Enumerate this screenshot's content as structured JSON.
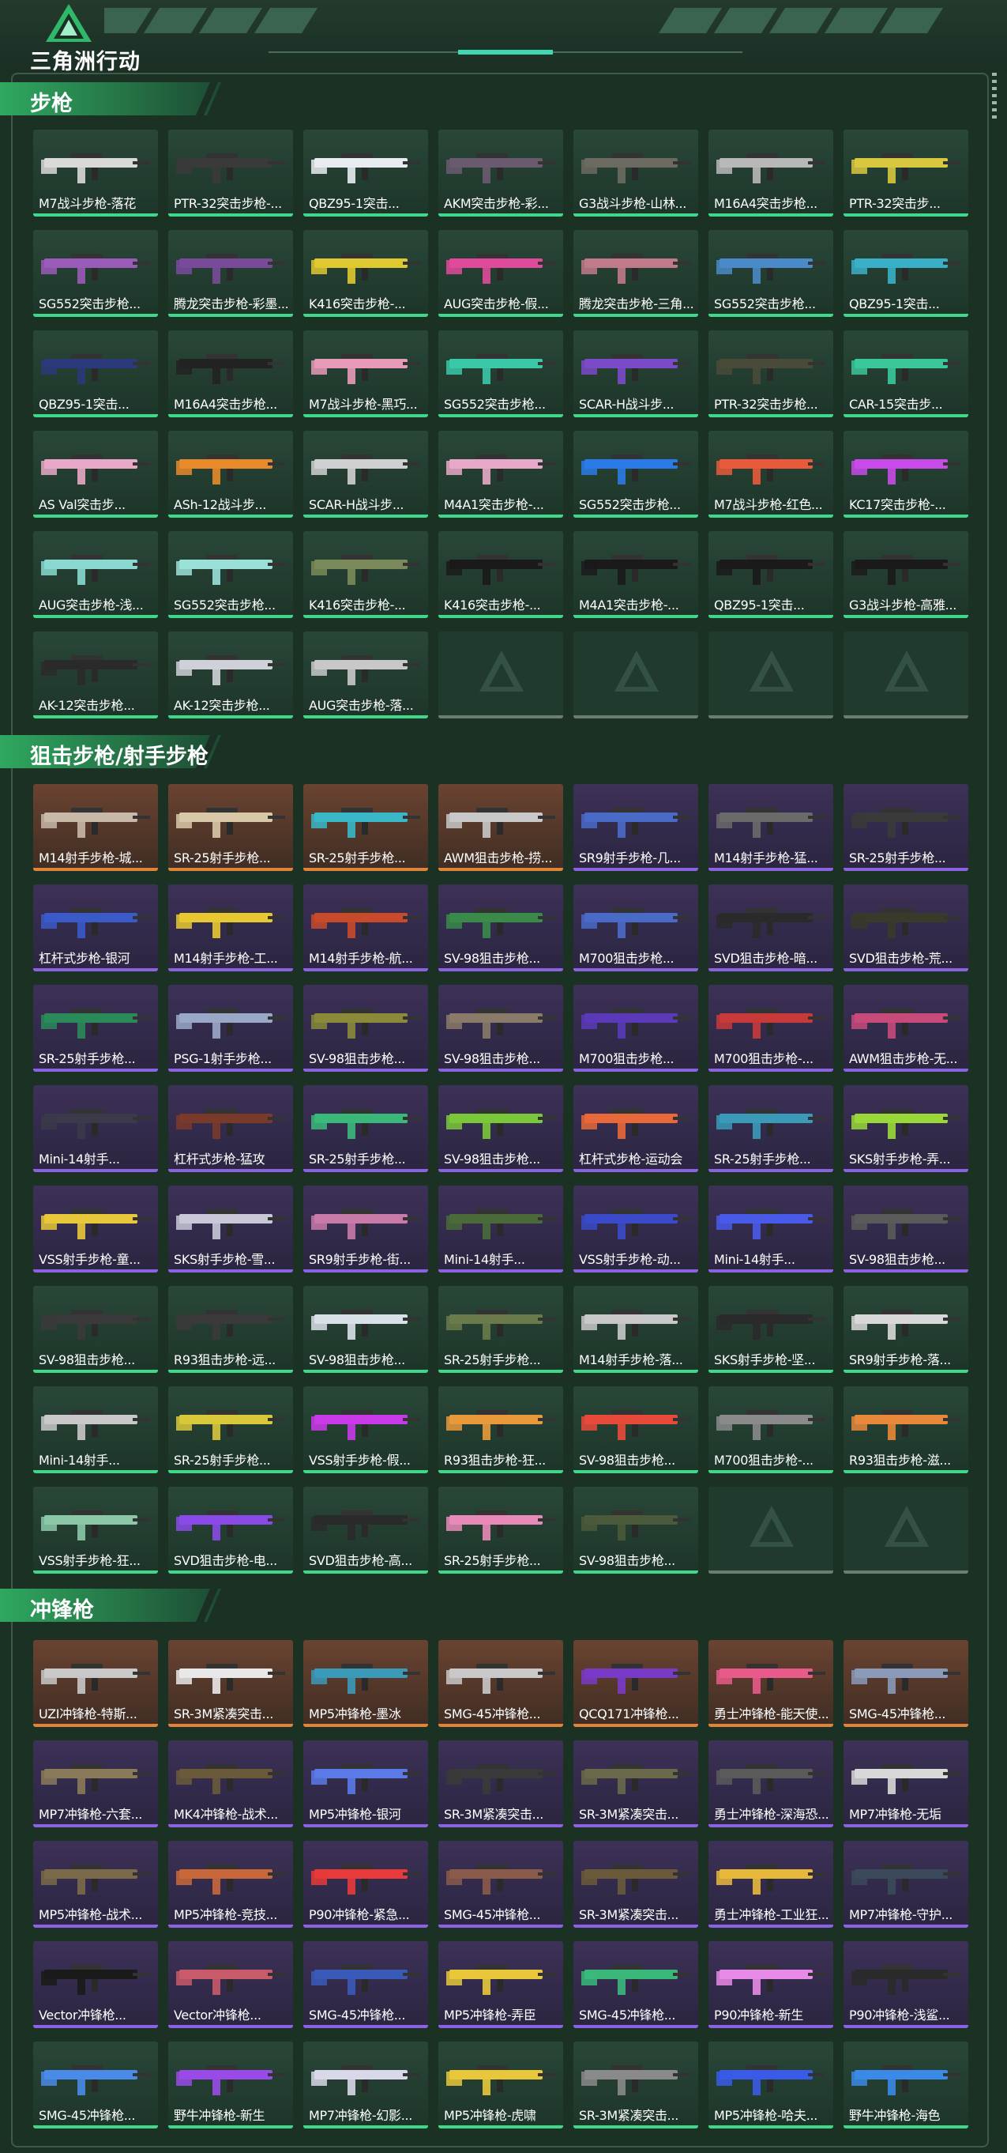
{
  "header": {
    "brand": "三角洲行动",
    "logo_icon": "delta-triangle-logo-icon"
  },
  "colors": {
    "green_rarity": "#3fd88a",
    "purple_rarity": "#8b63e0",
    "orange_rarity": "#e0843a",
    "background": "#1a3124"
  },
  "sections": [
    {
      "title": "步枪",
      "items": [
        {
          "label": "M7战斗步枪-落花",
          "rarity": "green",
          "color": "#d9dad8"
        },
        {
          "label": "PTR-32突击步枪-...",
          "rarity": "green",
          "color": "#3a3a3a"
        },
        {
          "label": "QBZ95-1突击...",
          "rarity": "green",
          "color": "#e8ecf0"
        },
        {
          "label": "AKM突击步枪-彩...",
          "rarity": "green",
          "color": "#6a5a70"
        },
        {
          "label": "G3战斗步枪-山林...",
          "rarity": "green",
          "color": "#6a6a60"
        },
        {
          "label": "M16A4突击步枪...",
          "rarity": "green",
          "color": "#b8b8b8"
        },
        {
          "label": "PTR-32突击步...",
          "rarity": "green",
          "color": "#d8c840"
        },
        {
          "label": "SG552突击步枪...",
          "rarity": "green",
          "color": "#9a5ab8"
        },
        {
          "label": "腾龙突击步枪-彩墨...",
          "rarity": "green",
          "color": "#7a4a9a"
        },
        {
          "label": "K416突击步枪-...",
          "rarity": "green",
          "color": "#e0c830"
        },
        {
          "label": "AUG突击步枪-假...",
          "rarity": "green",
          "color": "#e04a9a"
        },
        {
          "label": "腾龙突击步枪-三角...",
          "rarity": "green",
          "color": "#c07a8a"
        },
        {
          "label": "SG552突击步枪...",
          "rarity": "green",
          "color": "#4a8ac8"
        },
        {
          "label": "QBZ95-1突击...",
          "rarity": "green",
          "color": "#3ab0c8"
        },
        {
          "label": "QBZ95-1突击...",
          "rarity": "green",
          "color": "#2a3a7a"
        },
        {
          "label": "M16A4突击步枪...",
          "rarity": "green",
          "color": "#222222"
        },
        {
          "label": "M7战斗步枪-黑巧...",
          "rarity": "green",
          "color": "#e89ab8"
        },
        {
          "label": "SG552突击步枪...",
          "rarity": "green",
          "color": "#3ac8a8"
        },
        {
          "label": "SCAR-H战斗步...",
          "rarity": "green",
          "color": "#7a4ac8"
        },
        {
          "label": "PTR-32突击步枪...",
          "rarity": "green",
          "color": "#4a4a3a"
        },
        {
          "label": "CAR-15突击步...",
          "rarity": "green",
          "color": "#3ac89a"
        },
        {
          "label": "AS Val突击步...",
          "rarity": "green",
          "color": "#e8a8c8"
        },
        {
          "label": "ASh-12战斗步...",
          "rarity": "green",
          "color": "#e88a2a"
        },
        {
          "label": "SCAR-H战斗步...",
          "rarity": "green",
          "color": "#d0d0d0"
        },
        {
          "label": "M4A1突击步枪-...",
          "rarity": "green",
          "color": "#e8a8c8"
        },
        {
          "label": "SG552突击步枪...",
          "rarity": "green",
          "color": "#2a7ae8"
        },
        {
          "label": "M7战斗步枪-红色...",
          "rarity": "green",
          "color": "#e85a3a"
        },
        {
          "label": "KC17突击步枪-...",
          "rarity": "green",
          "color": "#c84ae8"
        },
        {
          "label": "AUG突击步枪-浅...",
          "rarity": "green",
          "color": "#8ad8d0"
        },
        {
          "label": "SG552突击步枪...",
          "rarity": "green",
          "color": "#9ae0d8"
        },
        {
          "label": "K416突击步枪-...",
          "rarity": "green",
          "color": "#7a8a5a"
        },
        {
          "label": "K416突击步枪-...",
          "rarity": "green",
          "color": "#1a1a1a"
        },
        {
          "label": "M4A1突击步枪-...",
          "rarity": "green",
          "color": "#1a1a1a"
        },
        {
          "label": "QBZ95-1突击...",
          "rarity": "green",
          "color": "#1a1a1a"
        },
        {
          "label": "G3战斗步枪-高雅...",
          "rarity": "green",
          "color": "#1a1a1a"
        },
        {
          "label": "AK-12突击步枪...",
          "rarity": "green",
          "color": "#2a2a2a"
        },
        {
          "label": "AK-12突击步枪...",
          "rarity": "green",
          "color": "#d0d0d8"
        },
        {
          "label": "AUG突击步枪-落...",
          "rarity": "green",
          "color": "#c8c8c8"
        }
      ],
      "empty_slots": 4
    },
    {
      "title": "狙击步枪/射手步枪",
      "items": [
        {
          "label": "M14射手步枪-城...",
          "rarity": "orange",
          "color": "#c8b8a8"
        },
        {
          "label": "SR-25射手步枪...",
          "rarity": "orange",
          "color": "#d8c8a8"
        },
        {
          "label": "SR-25射手步枪...",
          "rarity": "orange",
          "color": "#3ab8c8"
        },
        {
          "label": "AWM狙击步枪-捞...",
          "rarity": "orange",
          "color": "#c8c8c8"
        },
        {
          "label": "SR9射手步枪-几...",
          "rarity": "purple",
          "color": "#4a6ac8"
        },
        {
          "label": "M14射手步枪-猛...",
          "rarity": "purple",
          "color": "#6a6a6a"
        },
        {
          "label": "SR-25射手步枪...",
          "rarity": "purple",
          "color": "#3a3a3a"
        },
        {
          "label": "杠杆式步枪-银河",
          "rarity": "purple",
          "color": "#3a5ac8"
        },
        {
          "label": "M14射手步枪-工...",
          "rarity": "purple",
          "color": "#e8c830"
        },
        {
          "label": "M14射手步枪-航...",
          "rarity": "purple",
          "color": "#c84a2a"
        },
        {
          "label": "SV-98狙击步枪...",
          "rarity": "purple",
          "color": "#3a8a4a"
        },
        {
          "label": "M700狙击步枪...",
          "rarity": "purple",
          "color": "#4a6ac8"
        },
        {
          "label": "SVD狙击步枪-暗...",
          "rarity": "purple",
          "color": "#2a2a2a"
        },
        {
          "label": "SVD狙击步枪-荒...",
          "rarity": "purple",
          "color": "#3a3a2a"
        },
        {
          "label": "SR-25射手步枪...",
          "rarity": "purple",
          "color": "#2a8a5a"
        },
        {
          "label": "PSG-1射手步枪...",
          "rarity": "purple",
          "color": "#9aa8c8"
        },
        {
          "label": "SV-98狙击步枪...",
          "rarity": "purple",
          "color": "#8a8a3a"
        },
        {
          "label": "SV-98狙击步枪...",
          "rarity": "purple",
          "color": "#8a7a6a"
        },
        {
          "label": "M700狙击步枪...",
          "rarity": "purple",
          "color": "#5a3ab8"
        },
        {
          "label": "M700狙击步枪-...",
          "rarity": "purple",
          "color": "#c83a3a"
        },
        {
          "label": "AWM狙击步枪-无...",
          "rarity": "purple",
          "color": "#c84a7a"
        },
        {
          "label": "Mini-14射手...",
          "rarity": "purple",
          "color": "#3a3a4a"
        },
        {
          "label": "杠杆式步枪-猛攻",
          "rarity": "purple",
          "color": "#7a3a2a"
        },
        {
          "label": "SR-25射手步枪...",
          "rarity": "purple",
          "color": "#3ab87a"
        },
        {
          "label": "SV-98狙击步枪...",
          "rarity": "purple",
          "color": "#7ac83a"
        },
        {
          "label": "杠杆式步枪-运动会",
          "rarity": "purple",
          "color": "#e8683a"
        },
        {
          "label": "SR-25射手步枪...",
          "rarity": "purple",
          "color": "#3a9ab8"
        },
        {
          "label": "SKS射手步枪-弄...",
          "rarity": "purple",
          "color": "#9ad83a"
        },
        {
          "label": "VSS射手步枪-童...",
          "rarity": "purple",
          "color": "#e8c83a"
        },
        {
          "label": "SKS射手步枪-雪...",
          "rarity": "purple",
          "color": "#c8c8d8"
        },
        {
          "label": "SR9射手步枪-街...",
          "rarity": "purple",
          "color": "#c87aa8"
        },
        {
          "label": "Mini-14射手...",
          "rarity": "purple",
          "color": "#4a6a3a"
        },
        {
          "label": "VSS射手步枪-动...",
          "rarity": "purple",
          "color": "#3a4ac8"
        },
        {
          "label": "Mini-14射手...",
          "rarity": "purple",
          "color": "#4a5ae8"
        },
        {
          "label": "SV-98狙击步枪...",
          "rarity": "purple",
          "color": "#5a5a5a"
        },
        {
          "label": "SV-98狙击步枪...",
          "rarity": "green",
          "color": "#3a3a3a"
        },
        {
          "label": "R93狙击步枪-远...",
          "rarity": "green",
          "color": "#3a3a3a"
        },
        {
          "label": "SV-98狙击步枪...",
          "rarity": "green",
          "color": "#d8e0e8"
        },
        {
          "label": "SR-25射手步枪...",
          "rarity": "green",
          "color": "#6a7a4a"
        },
        {
          "label": "M14射手步枪-落...",
          "rarity": "green",
          "color": "#c8c8c8"
        },
        {
          "label": "SKS射手步枪-坚...",
          "rarity": "green",
          "color": "#2a2a2a"
        },
        {
          "label": "SR9射手步枪-落...",
          "rarity": "green",
          "color": "#d8d8d8"
        },
        {
          "label": "Mini-14射手...",
          "rarity": "green",
          "color": "#c8c8c8"
        },
        {
          "label": "SR-25射手步枪...",
          "rarity": "green",
          "color": "#d8c83a"
        },
        {
          "label": "VSS射手步枪-假...",
          "rarity": "green",
          "color": "#c83ae8"
        },
        {
          "label": "R93狙击步枪-狂...",
          "rarity": "green",
          "color": "#e89a3a"
        },
        {
          "label": "SV-98狙击步枪...",
          "rarity": "green",
          "color": "#e84a3a"
        },
        {
          "label": "M700狙击步枪-...",
          "rarity": "green",
          "color": "#8a8a8a"
        },
        {
          "label": "R93狙击步枪-滋...",
          "rarity": "green",
          "color": "#e8883a"
        },
        {
          "label": "VSS射手步枪-狂...",
          "rarity": "green",
          "color": "#8ac8a8"
        },
        {
          "label": "SVD狙击步枪-电...",
          "rarity": "green",
          "color": "#8a4ae8"
        },
        {
          "label": "SVD狙击步枪-高...",
          "rarity": "green",
          "color": "#2a2a2a"
        },
        {
          "label": "SR-25射手步枪...",
          "rarity": "green",
          "color": "#e88ab8"
        },
        {
          "label": "SV-98狙击步枪...",
          "rarity": "green",
          "color": "#4a5a3a"
        }
      ],
      "empty_slots": 2
    },
    {
      "title": "冲锋枪",
      "items": [
        {
          "label": "UZI冲锋枪-特斯...",
          "rarity": "orange",
          "color": "#c8c8c8"
        },
        {
          "label": "SR-3M紧凑突击...",
          "rarity": "orange",
          "color": "#e8e8e8"
        },
        {
          "label": "MP5冲锋枪-墨冰",
          "rarity": "orange",
          "color": "#3a9ab8"
        },
        {
          "label": "SMG-45冲锋枪...",
          "rarity": "orange",
          "color": "#c8c8c8"
        },
        {
          "label": "QCQ171冲锋枪...",
          "rarity": "orange",
          "color": "#7a3ac8"
        },
        {
          "label": "勇士冲锋枪-能天使...",
          "rarity": "orange",
          "color": "#e85a8a"
        },
        {
          "label": "SMG-45冲锋枪...",
          "rarity": "orange",
          "color": "#8a9ab8"
        },
        {
          "label": "MP7冲锋枪-六套...",
          "rarity": "purple",
          "color": "#8a7a5a"
        },
        {
          "label": "MK4冲锋枪-战术...",
          "rarity": "purple",
          "color": "#6a5a3a"
        },
        {
          "label": "MP5冲锋枪-银河",
          "rarity": "purple",
          "color": "#5a7ae8"
        },
        {
          "label": "SR-3M紧凑突击...",
          "rarity": "purple",
          "color": "#3a3a3a"
        },
        {
          "label": "SR-3M紧凑突击...",
          "rarity": "purple",
          "color": "#6a6a4a"
        },
        {
          "label": "勇士冲锋枪-深海恐...",
          "rarity": "purple",
          "color": "#5a5a5a"
        },
        {
          "label": "MP7冲锋枪-无垢",
          "rarity": "purple",
          "color": "#d8d8d8"
        },
        {
          "label": "MP5冲锋枪-战术...",
          "rarity": "purple",
          "color": "#7a6a4a"
        },
        {
          "label": "MP5冲锋枪-竞技...",
          "rarity": "purple",
          "color": "#c8683a"
        },
        {
          "label": "P90冲锋枪-紧急...",
          "rarity": "purple",
          "color": "#e83a3a"
        },
        {
          "label": "SMG-45冲锋枪...",
          "rarity": "purple",
          "color": "#8a5a4a"
        },
        {
          "label": "SR-3M紧凑突击...",
          "rarity": "purple",
          "color": "#6a5a3a"
        },
        {
          "label": "勇士冲锋枪-工业狂...",
          "rarity": "purple",
          "color": "#e8b83a"
        },
        {
          "label": "MP7冲锋枪-守护...",
          "rarity": "purple",
          "color": "#3a4a5a"
        },
        {
          "label": "Vector冲锋枪...",
          "rarity": "purple",
          "color": "#1a1a1a"
        },
        {
          "label": "Vector冲锋枪...",
          "rarity": "purple",
          "color": "#c85a6a"
        },
        {
          "label": "SMG-45冲锋枪...",
          "rarity": "purple",
          "color": "#3a5ab8"
        },
        {
          "label": "MP5冲锋枪-弄臣",
          "rarity": "purple",
          "color": "#e8c83a"
        },
        {
          "label": "SMG-45冲锋枪...",
          "rarity": "purple",
          "color": "#3ab87a"
        },
        {
          "label": "P90冲锋枪-新生",
          "rarity": "purple",
          "color": "#e88ae8"
        },
        {
          "label": "P90冲锋枪-浅鲨...",
          "rarity": "purple",
          "color": "#2a2a2a"
        },
        {
          "label": "SMG-45冲锋枪...",
          "rarity": "green",
          "color": "#4a8ae8"
        },
        {
          "label": "野牛冲锋枪-新生",
          "rarity": "green",
          "color": "#9a4ae8"
        },
        {
          "label": "MP7冲锋枪-幻影...",
          "rarity": "green",
          "color": "#d8d8e8"
        },
        {
          "label": "MP5冲锋枪-虎啸",
          "rarity": "green",
          "color": "#e8c83a"
        },
        {
          "label": "SR-3M紧凑突击...",
          "rarity": "green",
          "color": "#8a8a8a"
        },
        {
          "label": "MP5冲锋枪-哈夫...",
          "rarity": "green",
          "color": "#3a5ae8"
        },
        {
          "label": "野牛冲锋枪-海色",
          "rarity": "green",
          "color": "#3a8ae8"
        }
      ],
      "empty_slots": 0
    }
  ]
}
